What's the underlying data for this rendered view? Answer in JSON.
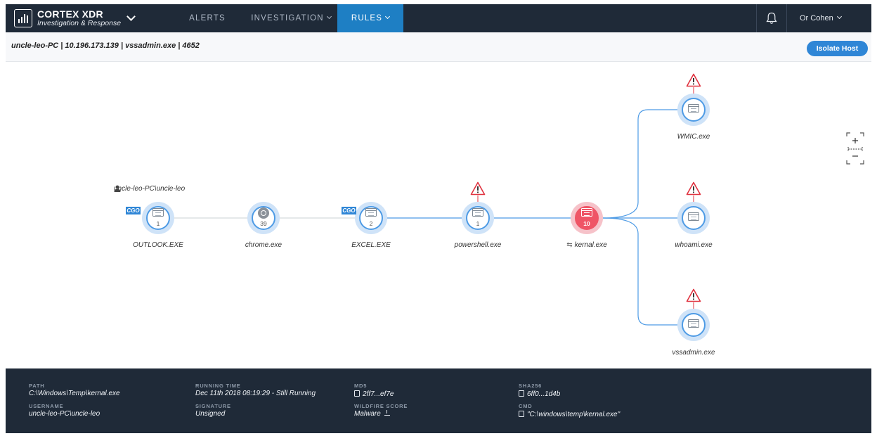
{
  "app": {
    "name": "CORTEX XDR",
    "subtitle": "Investigation & Response"
  },
  "nav": {
    "items": [
      {
        "label": "ALERTS",
        "active": false,
        "has_menu": false
      },
      {
        "label": "INVESTIGATION",
        "active": false,
        "has_menu": true
      },
      {
        "label": "RULES",
        "active": true,
        "has_menu": true
      }
    ],
    "user": "Or Cohen"
  },
  "header": {
    "breadcrumb": "uncle-leo-PC | 10.196.173.139 | vssadmin.exe | 4652",
    "isolate_button": "Isolate Host"
  },
  "graph": {
    "user_label": "uncle-leo-PC\\uncle-leo",
    "cgo_badge": "CGO",
    "nodes": [
      {
        "id": "outlook",
        "label": "OUTLOOK.EXE",
        "count": "1",
        "icon": "window-icon",
        "cgo": true,
        "alert": false,
        "highlight": false
      },
      {
        "id": "chrome",
        "label": "chrome.exe",
        "count": "39",
        "icon": "chrome-icon",
        "cgo": false,
        "alert": false,
        "highlight": false
      },
      {
        "id": "excel",
        "label": "EXCEL.EXE",
        "count": "2",
        "icon": "window-icon",
        "cgo": true,
        "alert": false,
        "highlight": false
      },
      {
        "id": "powershell",
        "label": "powershell.exe",
        "count": "1",
        "icon": "window-icon",
        "cgo": false,
        "alert": true,
        "highlight": false
      },
      {
        "id": "kernal",
        "label": "kernal.exe",
        "count": "10",
        "icon": "window-icon",
        "cgo": false,
        "alert": false,
        "highlight": true
      },
      {
        "id": "wmic",
        "label": "WMIC.exe",
        "count": "",
        "icon": "window-icon",
        "cgo": false,
        "alert": true,
        "highlight": false
      },
      {
        "id": "whoami",
        "label": "whoami.exe",
        "count": "",
        "icon": "window-icon",
        "cgo": false,
        "alert": true,
        "highlight": false
      },
      {
        "id": "vssadmin",
        "label": "vssadmin.exe",
        "count": "",
        "icon": "window-icon",
        "cgo": false,
        "alert": true,
        "highlight": false
      }
    ]
  },
  "details": {
    "path": {
      "label": "PATH",
      "value": "C:\\Windows\\Temp\\kernal.exe"
    },
    "username": {
      "label": "USERNAME",
      "value": "uncle-leo-PC\\uncle-leo"
    },
    "running_time": {
      "label": "RUNNING TIME",
      "value": "Dec 11th 2018 08:19:29 - Still Running"
    },
    "signature": {
      "label": "SIGNATURE",
      "value": "Unsigned"
    },
    "md5": {
      "label": "MD5",
      "value": "2ff7...ef7e"
    },
    "wildfire": {
      "label": "WILDFIRE SCORE",
      "value": "Malware"
    },
    "sha256": {
      "label": "SHA256",
      "value": "6ff0...1d4b"
    },
    "cmd": {
      "label": "CMD",
      "value": "\"C:\\windows\\temp\\kernal.exe\""
    }
  },
  "colors": {
    "nav_bg": "#1f2a38",
    "accent": "#2f86d6",
    "edge": "#4e9be5",
    "highlight_node": "#ef5566",
    "alert": "#e0323f"
  }
}
